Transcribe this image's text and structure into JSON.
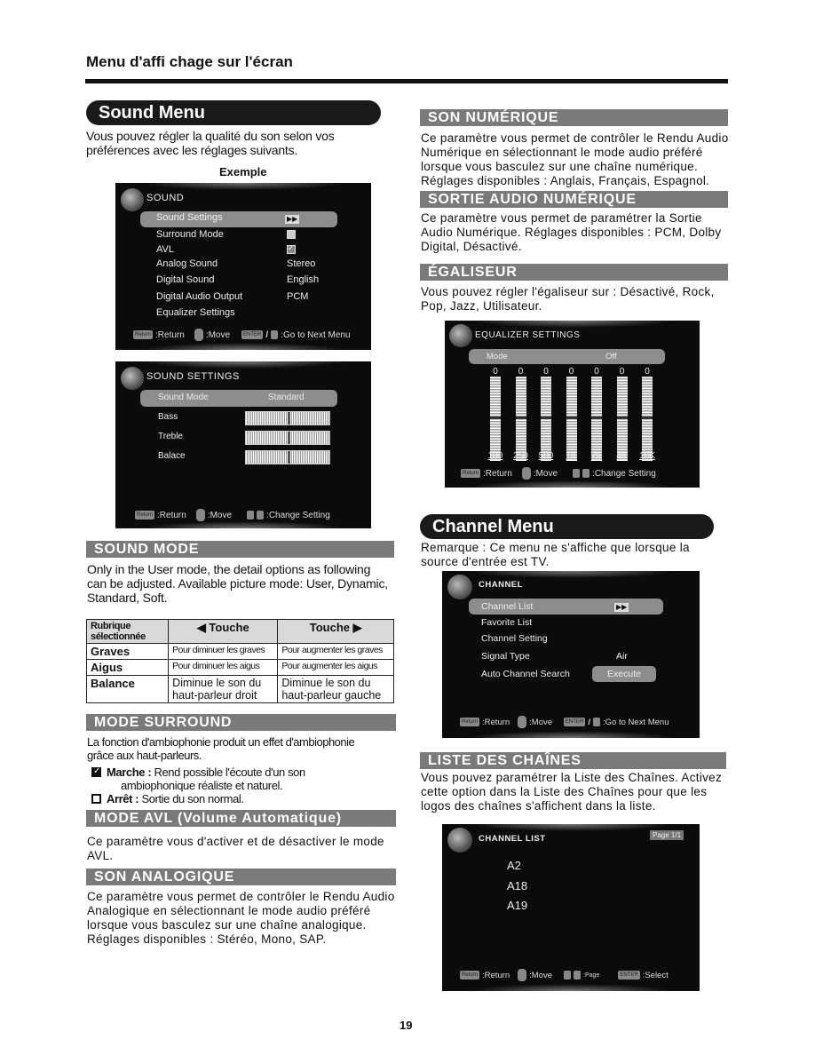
{
  "page": {
    "title": "Menu d'affi chage sur l'écran",
    "page_number": "19"
  },
  "left": {
    "sound_menu": {
      "heading": "Sound Menu",
      "intro": [
        "Vous pouvez régler la qualité du son selon vos",
        "préférences avec les réglages suivants."
      ],
      "example_caption": "Exemple"
    },
    "sound_screen": {
      "title": "SOUND",
      "items": [
        {
          "label": "Sound Settings",
          "value": "▶▶",
          "selected": true
        },
        {
          "label": "Surround Mode",
          "value": "",
          "checkbox": false
        },
        {
          "label": "AVL",
          "value": "",
          "checkbox": true
        },
        {
          "label": "Analog Sound",
          "value": "Stereo"
        },
        {
          "label": "Digital Sound",
          "value": "English"
        },
        {
          "label": "Digital Audio Output",
          "value": "PCM"
        },
        {
          "label": "Equalizer Settings",
          "value": ""
        }
      ],
      "footer": {
        "return_key": "Return",
        "return_label": ":Return",
        "move_label": ":Move",
        "enter_key": "ENTER",
        "next_label": ":Go to Next Menu"
      }
    },
    "sound_settings_screen": {
      "title": "SOUND SETTINGS",
      "selected": {
        "label": "Sound Mode",
        "value": "Standard"
      },
      "sliders": [
        {
          "label": "Bass",
          "level": 0.5
        },
        {
          "label": "Treble",
          "level": 0.5
        },
        {
          "label": "Balace",
          "level": 0.5
        }
      ],
      "footer": {
        "return_key": "Return",
        "return_label": ":Return",
        "move_label": ":Move",
        "change_label": ":Change Setting"
      }
    },
    "sound_mode": {
      "heading": "SOUND MODE",
      "text": [
        "Only in the User mode, the detail options as following",
        "can  be adjusted. Available picture mode: User, Dynamic,",
        "Standard, Soft."
      ],
      "table": {
        "headers": [
          "Rubrique sélectionnée",
          "◀ Touche",
          "Touche ▶"
        ],
        "rows": [
          [
            "Graves",
            "Pour diminuer les graves",
            "Pour augmenter les graves"
          ],
          [
            "Aigus",
            "Pour diminuer les aigus",
            "Pour augmenter les aigus"
          ],
          [
            "Balance",
            "Diminue le son du haut-parleur droit",
            "Diminue le son du haut-parleur gauche"
          ]
        ]
      }
    },
    "mode_surround": {
      "heading": "MODE SURROUND",
      "text": [
        "La fonction d'ambiophonie produit un effet d'ambiophonie",
        "grâce aux haut-parleurs."
      ],
      "on_label": "Marche :",
      "on_text": "Rend possible l'écoute d'un son",
      "on_text2": "ambiophonique réaliste et naturel.",
      "off_label": "Arrêt :",
      "off_text": "Sortie du son normal."
    },
    "mode_avl": {
      "heading": "MODE AVL (Volume Automatique)",
      "text": [
        "Ce paramètre vous d'activer et de désactiver le mode",
        "AVL."
      ]
    },
    "son_analogique": {
      "heading": "SON ANALOGIQUE",
      "text": [
        "Ce paramètre vous permet de contrôler le Rendu Audio",
        "Analogique en sélectionnant le mode audio préféré",
        "lorsque vous basculez sur une chaîne analogique.",
        "Réglages disponibles : Stéréo, Mono, SAP."
      ]
    }
  },
  "right": {
    "son_numerique": {
      "heading": "SON NUMÉRIQUE",
      "text": [
        "Ce paramètre vous permet de contrôler le Rendu Audio",
        "Numérique en sélectionnant le mode audio préféré",
        "lorsque vous basculez sur une chaîne numérique.",
        "Réglages disponibles : Anglais, Français, Espagnol."
      ]
    },
    "sortie_audio": {
      "heading": "SORTIE AUDIO NUMÉRIQUE",
      "text": [
        "Ce paramètre vous permet de paramétrer la Sortie",
        "Audio Numérique. Réglages disponibles : PCM, Dolby",
        "Digital, Désactivé."
      ]
    },
    "egaliseur": {
      "heading": "ÉGALISEUR",
      "text": [
        "Vous pouvez régler l'égaliseur sur : Désactivé, Rock,",
        "Pop, Jazz, Utilisateur."
      ]
    },
    "eq_screen": {
      "title": "EQUALIZER SETTINGS",
      "mode_label": "Mode",
      "mode_value": "Off",
      "bands": [
        {
          "freq": "100",
          "value": "0"
        },
        {
          "freq": "250",
          "value": "0"
        },
        {
          "freq": "500",
          "value": "0"
        },
        {
          "freq": "1K",
          "value": "0"
        },
        {
          "freq": "2K",
          "value": "0"
        },
        {
          "freq": "4K",
          "value": "0"
        },
        {
          "freq": "10K",
          "value": "0"
        }
      ],
      "footer": {
        "return_key": "Return",
        "return_label": ":Return",
        "move_label": ":Move",
        "change_label": ":Change  Setting"
      }
    },
    "channel_menu": {
      "heading": "Channel Menu",
      "text": [
        "Remarque : Ce menu ne s'affiche que lorsque la",
        "source d'entrée est TV."
      ]
    },
    "channel_screen": {
      "title": "CHANNEL",
      "items": [
        {
          "label": "Channel List",
          "value": "▶▶",
          "selected": true
        },
        {
          "label": "Favorite List",
          "value": ""
        },
        {
          "label": "Channel Setting",
          "value": ""
        },
        {
          "label": "Signal Type",
          "value": "Air"
        },
        {
          "label": "Auto Channel Search",
          "value": "Execute"
        }
      ],
      "footer": {
        "return_key": "Return",
        "return_label": ":Return",
        "move_label": ":Move",
        "enter_key": "ENTER",
        "next_label": ":Go to Next Menu"
      }
    },
    "liste_chaines": {
      "heading": "LISTE DES CHAÎNES",
      "text": [
        "Vous pouvez paramétrer la Liste des Chaînes. Activez",
        "cette option dans la Liste des Chaînes pour que les",
        "logos des chaînes s'affichent dans la liste."
      ]
    },
    "channel_list_screen": {
      "title": "CHANNEL  LIST",
      "page": "Page 1/1",
      "channels": [
        "A2",
        "A18",
        "A19"
      ],
      "footer": {
        "return_key": "Return",
        "return_label": ":Return",
        "move_label": ":Move",
        "page_label": ":Page",
        "enter_key": "ENTER",
        "select_label": ":Select"
      }
    }
  }
}
